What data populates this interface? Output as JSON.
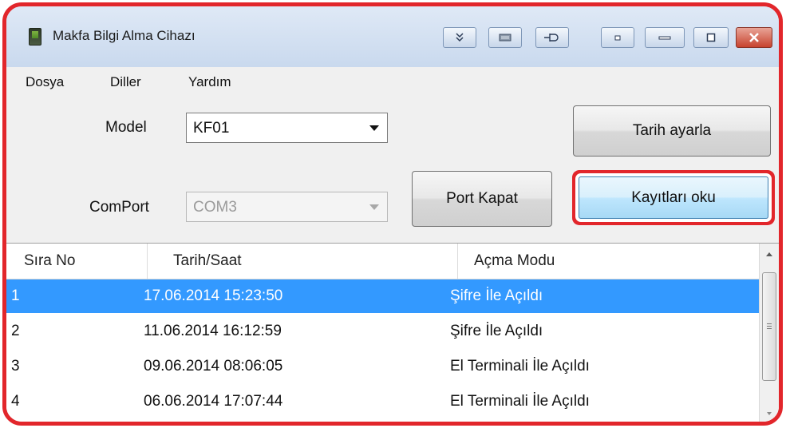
{
  "window": {
    "title": "Makfa Bilgi Alma Cihazı",
    "title_buttons": [
      "pin-icon",
      "keyboard-icon",
      "plug-icon",
      "minimize-small-icon",
      "minimize-icon",
      "restore-icon",
      "close-icon"
    ]
  },
  "menu": {
    "items": [
      "Dosya",
      "Diller",
      "Yardım"
    ]
  },
  "form": {
    "model_label": "Model",
    "model_value": "KF01",
    "comport_label": "ComPort",
    "comport_value": "COM3",
    "port_button": "Port Kapat",
    "date_button": "Tarih ayarla",
    "read_button": "Kayıtları oku"
  },
  "table": {
    "columns": [
      "Sıra No",
      "Tarih/Saat",
      "Açma Modu"
    ],
    "rows": [
      {
        "no": "1",
        "datetime": "17.06.2014 15:23:50",
        "mode": "Şifre İle Açıldı",
        "selected": true
      },
      {
        "no": "2",
        "datetime": "11.06.2014 16:12:59",
        "mode": "Şifre İle Açıldı",
        "selected": false
      },
      {
        "no": "3",
        "datetime": "09.06.2014 08:06:05",
        "mode": "El Terminali İle Açıldı",
        "selected": false
      },
      {
        "no": "4",
        "datetime": "06.06.2014 17:07:44",
        "mode": "El Terminali İle Açıldı",
        "selected": false
      }
    ]
  },
  "colors": {
    "highlight_frame": "#e2262b",
    "selection": "#3399ff"
  }
}
